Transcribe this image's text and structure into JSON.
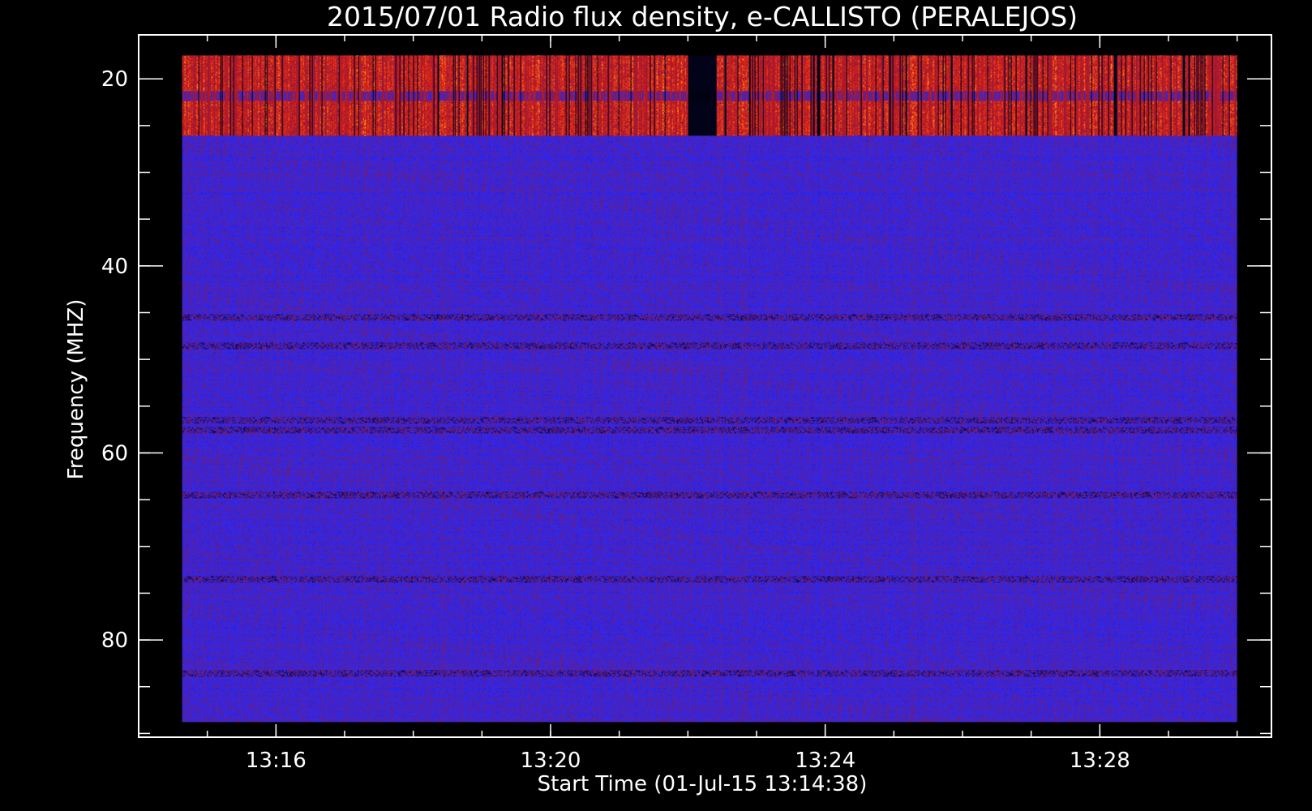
{
  "chart_data": {
    "type": "heatmap",
    "title": "2015/07/01  Radio flux density, e-CALLISTO (PERALEJOS)",
    "xlabel": "Start Time (01-Jul-15 13:14:38)",
    "ylabel": "Frequency (MHZ)",
    "x_unit": "HH:MM (UT)",
    "xlim": [
      "13:14:00",
      "13:30:30"
    ],
    "data_time_range": [
      "13:14:38",
      "13:30:00"
    ],
    "ylim": [
      15.3,
      90.4
    ],
    "data_freq_range": [
      17.5,
      88.8
    ],
    "y_inverted": true,
    "x_ticks": [
      "13:16",
      "13:20",
      "13:24",
      "13:28"
    ],
    "y_ticks": [
      20,
      40,
      60,
      80
    ],
    "x_minor_tick_step_seconds": 60,
    "y_minor_tick_step": 5,
    "grid": false,
    "colormap": [
      "#000000",
      "#1010c8",
      "#2a2aff",
      "#7a1a5a",
      "#c01818",
      "#ff3a10",
      "#ffd020"
    ],
    "features": {
      "strong_emission_band_mhz": [
        17.5,
        26.0
      ],
      "dropout_column_start": "13:22:00",
      "dropout_column_end": "13:22:25",
      "weak_horizontal_bands_mhz": [
        45.5,
        48.5,
        56.5,
        57.5,
        64.5,
        73.5,
        83.5
      ]
    }
  },
  "colors": {
    "background": "#000000",
    "axes": "#ffffff",
    "text": "#ffffff"
  }
}
